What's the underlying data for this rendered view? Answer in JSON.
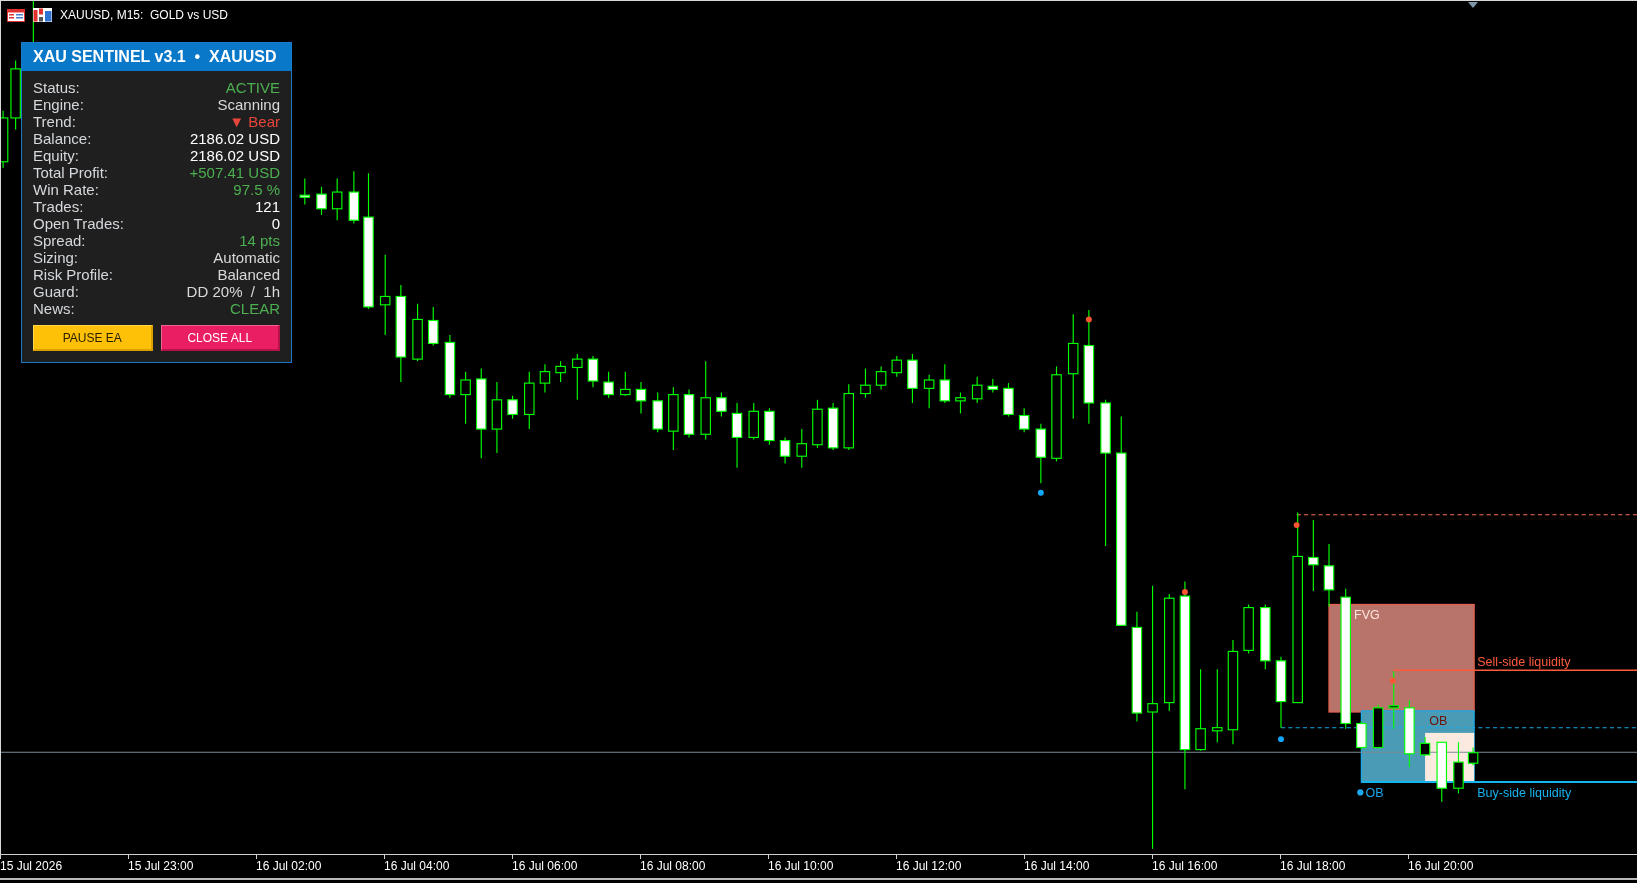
{
  "chart_header": {
    "title": "XAUUSD, M15:  GOLD vs USD"
  },
  "panel": {
    "title": "XAU SENTINEL v3.1  •  XAUUSD",
    "rows": [
      {
        "label": "Status:",
        "value": "ACTIVE",
        "color": "#4caf50"
      },
      {
        "label": "Engine:",
        "value": "Scanning",
        "color": "#d9d9d9"
      },
      {
        "label": "Trend:",
        "value": "▼ Bear",
        "color": "#e8453c"
      },
      {
        "label": "Balance:",
        "value": "2186.02 USD",
        "color": "#ffffff"
      },
      {
        "label": "Equity:",
        "value": "2186.02 USD",
        "color": "#ffffff"
      },
      {
        "label": "Total Profit:",
        "value": "+507.41 USD",
        "color": "#4caf50"
      },
      {
        "label": "Win Rate:",
        "value": "97.5 %",
        "color": "#4caf50"
      },
      {
        "label": "Trades:",
        "value": "121",
        "color": "#ffffff"
      },
      {
        "label": "Open Trades:",
        "value": "0",
        "color": "#ffffff"
      },
      {
        "label": "Spread:",
        "value": "14 pts",
        "color": "#4caf50"
      },
      {
        "label": "Sizing:",
        "value": "Automatic",
        "color": "#d9d9d9"
      },
      {
        "label": "Risk Profile:",
        "value": "Balanced",
        "color": "#d9d9d9"
      },
      {
        "label": "Guard:",
        "value": "DD 20%  /  1h",
        "color": "#d9d9d9"
      },
      {
        "label": "News:",
        "value": "CLEAR",
        "color": "#4caf50"
      }
    ],
    "buttons": [
      {
        "label": "PAUSE EA",
        "kind": "pause"
      },
      {
        "label": "CLOSE ALL",
        "kind": "close"
      }
    ]
  },
  "chart": {
    "zones": [
      {
        "label": "FVG",
        "kind": "fvg"
      },
      {
        "label": "OB",
        "kind": "demand"
      },
      {
        "label": "OB",
        "kind": "supply"
      }
    ],
    "liquidity": [
      {
        "label": "Sell-side liquidity",
        "kind": "sell"
      },
      {
        "label": "Buy-side liquidity",
        "kind": "buy"
      }
    ]
  },
  "time_axis": {
    "labels": [
      "15 Jul 2026",
      "15 Jul 23:00",
      "16 Jul 02:00",
      "16 Jul 04:00",
      "16 Jul 06:00",
      "16 Jul 08:00",
      "16 Jul 10:00",
      "16 Jul 12:00",
      "16 Jul 14:00",
      "16 Jul 16:00",
      "16 Jul 18:00",
      "16 Jul 20:00"
    ]
  }
}
